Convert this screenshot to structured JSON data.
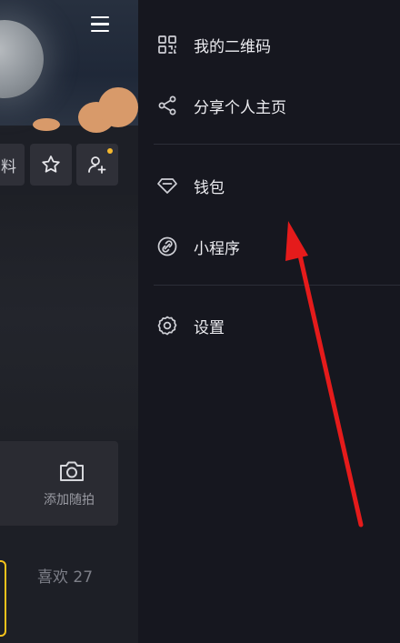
{
  "left_panel": {
    "buttons": {
      "edit_partial": "料",
      "star_icon": "star-icon",
      "add_friend_icon": "add-friend-icon"
    },
    "tile": {
      "label": "添加随拍",
      "icon": "camera-icon"
    },
    "likes": "喜欢 27",
    "menu_icon": "hamburger-menu-icon"
  },
  "drawer": {
    "items": [
      {
        "label": "我的二维码",
        "icon": "qr-code-icon"
      },
      {
        "label": "分享个人主页",
        "icon": "share-icon"
      },
      {
        "label": "钱包",
        "icon": "wallet-diamond-icon"
      },
      {
        "label": "小程序",
        "icon": "mini-program-icon"
      },
      {
        "label": "设置",
        "icon": "settings-gear-icon"
      }
    ]
  },
  "colors": {
    "annotation_arrow": "#e51b1b",
    "notification_dot": "#f5b82e",
    "drawer_bg": "#16171f"
  }
}
